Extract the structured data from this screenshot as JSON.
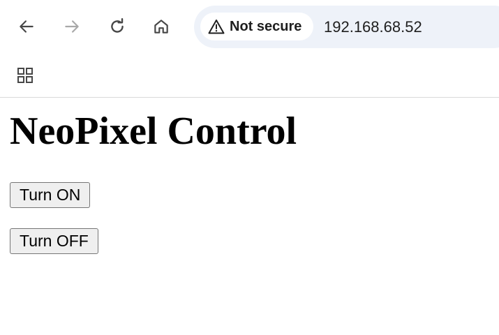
{
  "browser": {
    "nav": {
      "back_icon": "arrow-left-icon",
      "forward_icon": "arrow-right-icon",
      "reload_icon": "reload-icon",
      "home_icon": "home-icon"
    },
    "omnibox": {
      "security_icon": "warning-triangle-icon",
      "security_label": "Not secure",
      "url": "192.168.68.52"
    },
    "bookmarks_bar": {
      "apps_icon": "apps-grid-icon"
    }
  },
  "page": {
    "title": "NeoPixel Control",
    "buttons": [
      {
        "label": "Turn ON"
      },
      {
        "label": "Turn OFF"
      }
    ]
  },
  "colors": {
    "omnibox_bg": "#eef2f9",
    "icon_color": "#474747",
    "button_bg": "#efefef",
    "button_border": "#767676"
  }
}
